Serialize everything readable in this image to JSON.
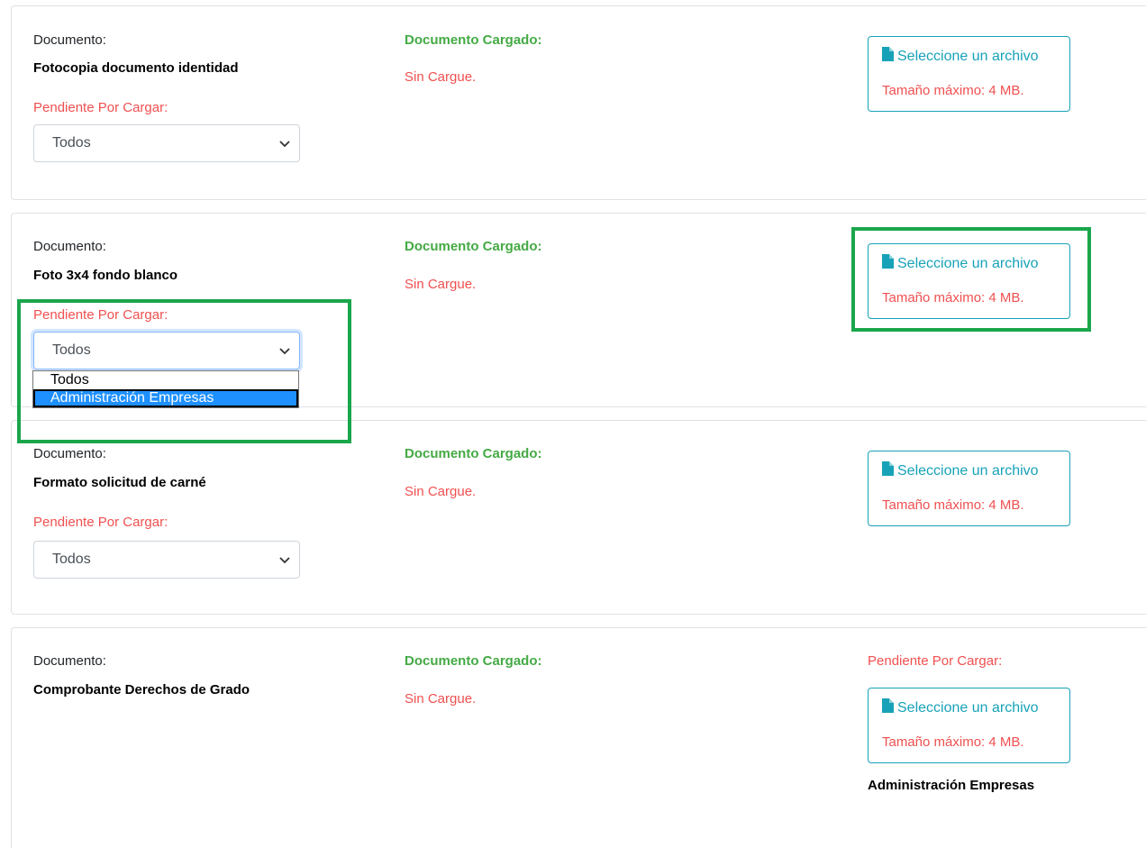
{
  "labels": {
    "document": "Documento:",
    "pending": "Pendiente Por Cargar:",
    "loaded": "Documento Cargado:",
    "no_upload": "Sin Cargue.",
    "select_file": "Seleccione un archivo",
    "max_size": "Tamaño máximo: 4 MB."
  },
  "colors": {
    "pending_red": "#f05050",
    "loaded_green": "#44aa44",
    "upload_teal": "#17a2b8",
    "highlight_green": "#1aa64b",
    "option_selected_blue": "#1e90ff"
  },
  "documents": [
    {
      "name": "Fotocopia documento identidad",
      "select_value": "Todos"
    },
    {
      "name": "Foto 3x4 fondo blanco",
      "select_value": "Todos",
      "dropdown_options": [
        "Todos",
        "Administración Empresas"
      ],
      "highlighted_option": "Administración Empresas"
    },
    {
      "name": "Formato solicitud de carné",
      "select_value": "Todos"
    },
    {
      "name": "Comprobante Derechos de Grado",
      "program": "Administración Empresas"
    }
  ],
  "icons": {
    "file": "file-icon",
    "chevron": "chevron-down-icon"
  }
}
